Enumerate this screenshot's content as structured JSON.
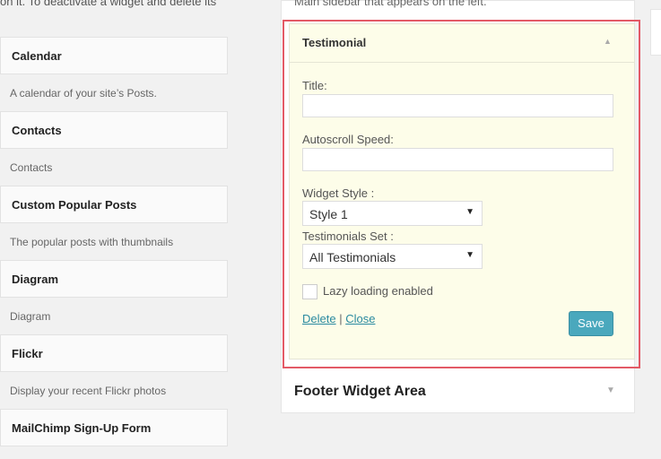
{
  "intro_text": "on it. To deactivate a widget and delete its",
  "available_widgets": [
    {
      "name": "Calendar",
      "description": "A calendar of your site’s Posts."
    },
    {
      "name": "Contacts",
      "description": "Contacts"
    },
    {
      "name": "Custom Popular Posts",
      "description": "The popular posts with thumbnails"
    },
    {
      "name": "Diagram",
      "description": "Diagram"
    },
    {
      "name": "Flickr",
      "description": "Display your recent Flickr photos"
    },
    {
      "name": "MailChimp Sign-Up Form",
      "description": ""
    }
  ],
  "sidebar": {
    "description": "Main sidebar that appears on the left."
  },
  "widget": {
    "title": "Testimonial",
    "title_label": "Title:",
    "title_value": "",
    "speed_label": "Autoscroll Speed:",
    "speed_value": "",
    "style_label": "Widget Style :",
    "style_value": "Style 1",
    "set_label": "Testimonials Set :",
    "set_value": "All Testimonials",
    "lazy_label": "Lazy loading enabled",
    "lazy_checked": false,
    "delete": "Delete",
    "separator": "|",
    "close": "Close",
    "save": "Save"
  },
  "footer_area": {
    "title": "Footer Widget Area"
  }
}
